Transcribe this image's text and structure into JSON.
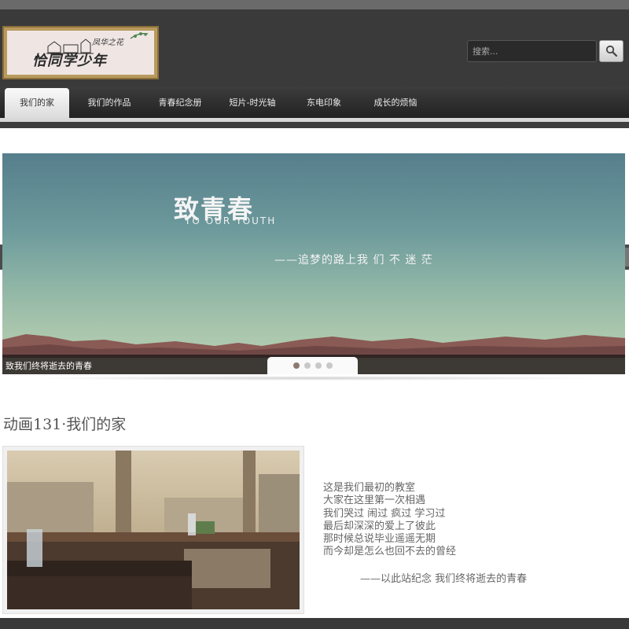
{
  "header": {
    "logo_text": "恰同学少年",
    "logo_signature": "凤华之花",
    "search_placeholder": "搜索..."
  },
  "nav": {
    "items": [
      {
        "label": "我们的家",
        "active": true
      },
      {
        "label": "我们的作品",
        "active": false
      },
      {
        "label": "青春纪念册",
        "active": false
      },
      {
        "label": "短片-时光轴",
        "active": false
      },
      {
        "label": "东电印象",
        "active": false
      },
      {
        "label": "成长的烦恼",
        "active": false
      }
    ]
  },
  "slider": {
    "title": "致青春",
    "subtitle": "TO OUR YOUTH",
    "quote": "——追梦的路上我 们 不 迷 茫",
    "caption": "致我们终将逝去的青春",
    "dots": [
      true,
      false,
      false,
      false
    ]
  },
  "section": {
    "title": "动画131·我们的家",
    "poem": [
      "这是我们最初的教室",
      "大家在这里第一次相遇",
      "我们哭过 闹过 疯过 学习过",
      "最后却深深的爱上了彼此",
      "那时候总说毕业遥遥无期",
      "而今却是怎么也回不去的曾经"
    ],
    "signature": "——以此站纪念 我们终将逝去的青春"
  },
  "colors": {
    "header_bg": "#3a3a3a",
    "accent_dot": "#8c7a70"
  },
  "icons": {
    "search": "magnifier-icon"
  }
}
